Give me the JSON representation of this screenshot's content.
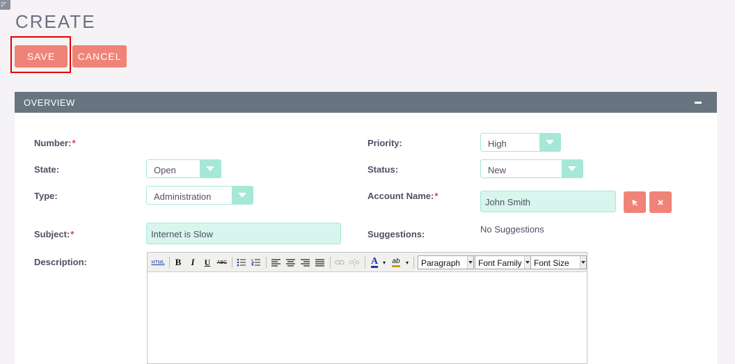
{
  "page": {
    "title": "CREATE"
  },
  "actions": {
    "save_label": "SAVE",
    "cancel_label": "CANCEL"
  },
  "panel": {
    "title": "OVERVIEW"
  },
  "fields": {
    "number": {
      "label": "Number:",
      "required": "*"
    },
    "state": {
      "label": "State:",
      "value": "Open"
    },
    "type": {
      "label": "Type:",
      "value": "Administration"
    },
    "subject": {
      "label": "Subject:",
      "required": "*",
      "value": "Internet is Slow"
    },
    "description": {
      "label": "Description:"
    },
    "priority": {
      "label": "Priority:",
      "value": "High"
    },
    "status": {
      "label": "Status:",
      "value": "New"
    },
    "account_name": {
      "label": "Account Name:",
      "required": "*",
      "value": "John Smith"
    },
    "suggestions": {
      "label": "Suggestions:",
      "value": "No Suggestions"
    }
  },
  "editor": {
    "html_label": "HTML",
    "bold": "B",
    "italic": "I",
    "underline": "U",
    "strike": "ABC",
    "font_color_glyph": "A",
    "highlight_glyph": "ab",
    "format_select": "Paragraph",
    "font_family_select": "Font Family",
    "font_size_select": "Font Size"
  },
  "colors": {
    "accent_button": "#f08377",
    "panel_header": "#687581",
    "select_accent": "#a5e8d6",
    "input_fill": "#d8f5ee",
    "required_mark": "#e0413a",
    "highlight_border": "#e00000"
  },
  "icons": {
    "select_account": "cursor-arrow-icon",
    "clear_account": "close-icon",
    "collapse_panel": "minus-icon"
  }
}
